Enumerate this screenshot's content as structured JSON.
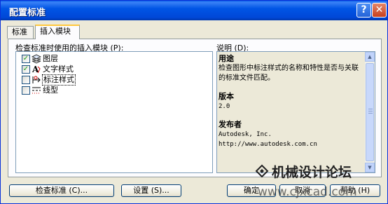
{
  "window": {
    "title": "配置标准"
  },
  "tabs": [
    {
      "label": "标准"
    },
    {
      "label": "插入模块"
    }
  ],
  "plugins": {
    "list_label": "检查标准时使用的插入模块 (P):",
    "items": [
      {
        "label": "图层",
        "checked": true,
        "icon": "layers-icon"
      },
      {
        "label": "文字样式",
        "checked": true,
        "icon": "text-style-icon"
      },
      {
        "label": "标注样式",
        "checked": false,
        "icon": "dimension-style-icon"
      },
      {
        "label": "线型",
        "checked": false,
        "icon": "linetype-icon"
      }
    ]
  },
  "description": {
    "label": "说明 (D):",
    "purpose_heading": "用途",
    "purpose_text": "检查图形中标注样式的名称和特性是否与关联的标准文件匹配。",
    "version_heading": "版本",
    "version_value": "2.0",
    "publisher_heading": "发布者",
    "publisher_name": "Autodesk, Inc.",
    "publisher_url": "http://www.autodesk.com.cn"
  },
  "buttons": {
    "check": "检查标准 (C)...",
    "settings": "设置 (S)...",
    "ok": "确定",
    "cancel": "取消",
    "help": "帮助 (H)"
  },
  "watermark": {
    "cn": "机械设计论坛",
    "url": "www.cjxcad.com"
  },
  "colors": {
    "title_bar": "#0055e5",
    "tab_highlight": "#ffc83c",
    "check": "#21a121"
  }
}
